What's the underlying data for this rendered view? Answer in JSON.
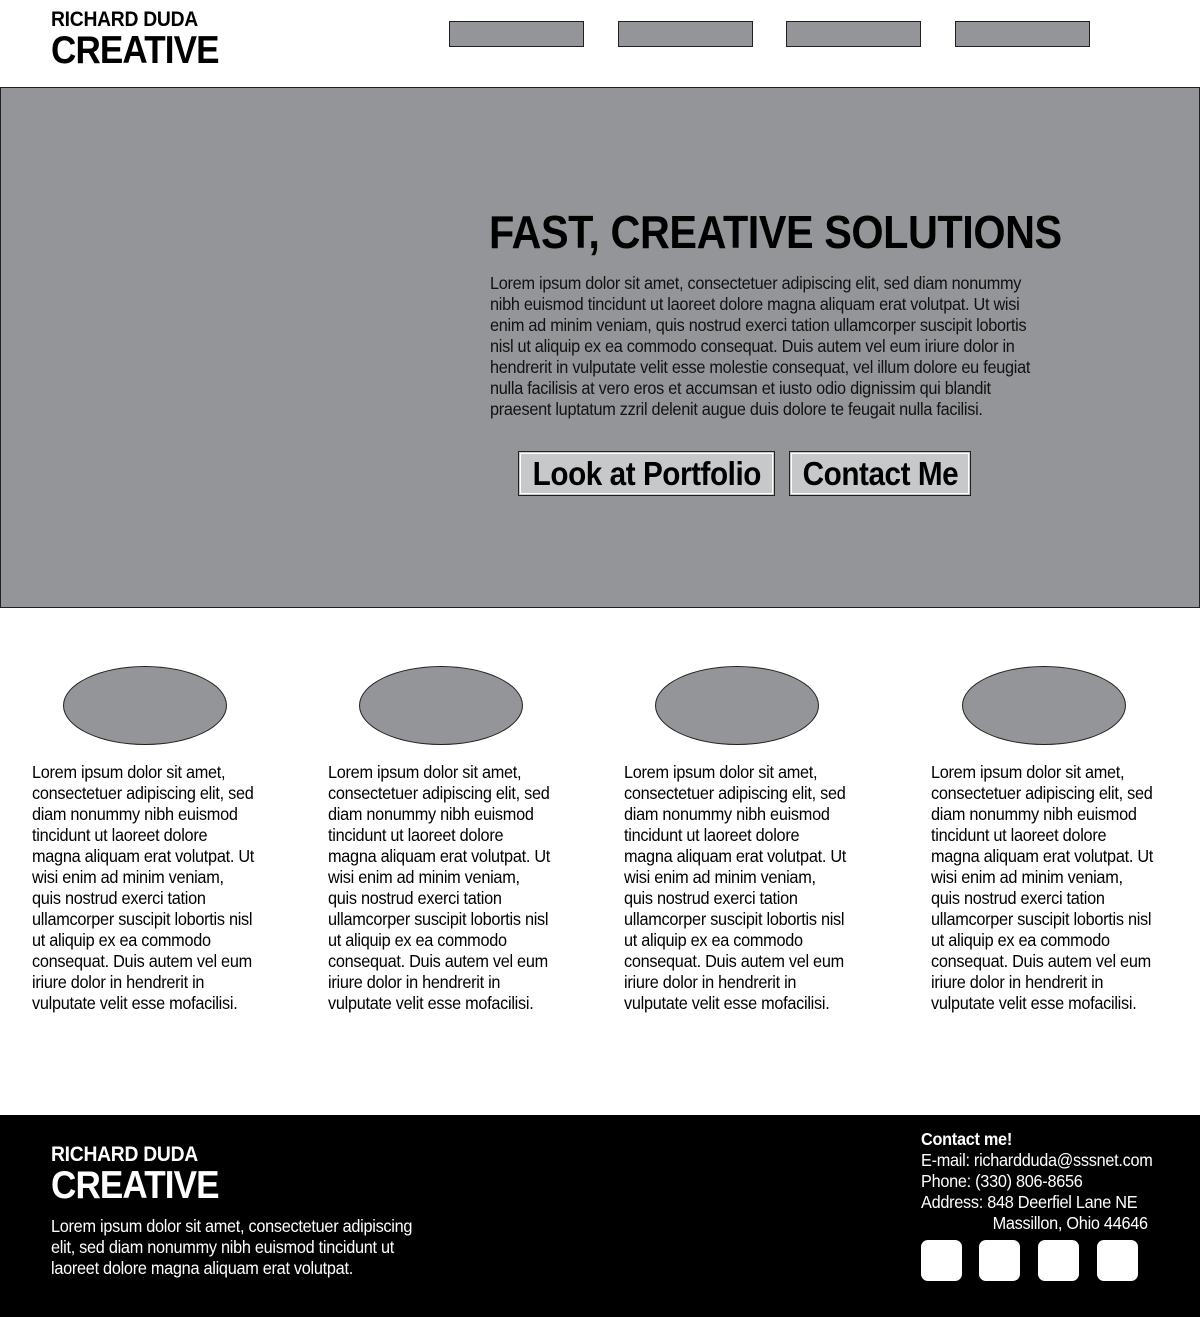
{
  "header": {
    "logo_line1": "RICHARD DUDA",
    "logo_line2": "CREATIVE",
    "nav_items": [
      "",
      "",
      "",
      ""
    ]
  },
  "hero": {
    "title": "FAST, CREATIVE SOLUTIONS",
    "text": "Lorem ipsum dolor sit amet, consectetuer adipiscing elit, sed diam nonummy nibh euismod tincidunt ut laoreet dolore magna aliquam erat volutpat. Ut wisi enim ad minim veniam, quis nostrud exerci tation ullamcorper suscipit lobortis nisl ut aliquip ex ea commodo consequat. Duis autem vel eum iriure dolor in hendrerit in vulputate velit esse molestie consequat, vel illum dolore eu feugiat nulla facilisis at vero eros et accumsan et iusto odio dignissim qui blandit praesent luptatum zzril delenit augue duis dolore te feugait nulla facilisi.",
    "portfolio_button": "Look at Portfolio",
    "contact_button": "Contact Me"
  },
  "features": [
    {
      "text": "Lorem ipsum dolor sit amet, consectetuer adipiscing elit, sed diam nonummy nibh euismod tincidunt ut laoreet dolore magna aliquam erat volutpat. Ut wisi enim ad minim veniam, quis nostrud exerci tation ullamcorper suscipit lobortis nisl ut aliquip ex ea commodo consequat. Duis autem vel eum iriure dolor in hendrerit in vulputate velit esse mofacilisi."
    },
    {
      "text": "Lorem ipsum dolor sit amet, consectetuer adipiscing elit, sed diam nonummy nibh euismod tincidunt ut laoreet dolore magna aliquam erat volutpat. Ut wisi enim ad minim veniam, quis nostrud exerci tation ullamcorper suscipit lobortis nisl ut aliquip ex ea commodo consequat. Duis autem vel eum iriure dolor in hendrerit in vulputate velit esse mofacilisi."
    },
    {
      "text": "Lorem ipsum dolor sit amet, consectetuer adipiscing elit, sed diam nonummy nibh euismod tincidunt ut laoreet dolore magna aliquam erat volutpat. Ut wisi enim ad minim veniam, quis nostrud exerci tation ullamcorper suscipit lobortis nisl ut aliquip ex ea commodo consequat. Duis autem vel eum iriure dolor in hendrerit in vulputate velit esse mofacilisi."
    },
    {
      "text": "Lorem ipsum dolor sit amet, consectetuer adipiscing elit, sed diam nonummy nibh euismod tincidunt ut laoreet dolore magna aliquam erat volutpat. Ut wisi enim ad minim veniam, quis nostrud exerci tation ullamcorper suscipit lobortis nisl ut aliquip ex ea commodo consequat. Duis autem vel eum iriure dolor in hendrerit in vulputate velit esse mofacilisi."
    }
  ],
  "footer": {
    "logo_line1": "RICHARD DUDA",
    "logo_line2": "CREATIVE",
    "text": "Lorem ipsum dolor sit amet, consectetuer adipiscing elit, sed diam nonummy nibh euismod tincidunt ut laoreet dolore magna aliquam erat volutpat.",
    "contact": {
      "heading": "Contact me!",
      "email": "E-mail: richardduda@sssnet.com",
      "phone": "Phone:  (330) 806-8656",
      "address_line1": "Address:  848 Deerfiel Lane NE",
      "address_line2": "Massillon, Ohio 44646"
    },
    "social_icons": [
      "social-icon-1",
      "social-icon-2",
      "social-icon-3",
      "social-icon-4"
    ]
  },
  "colors": {
    "placeholder_gray": "#939598",
    "button_gray": "#c7c8ca",
    "footer_bg": "#000000",
    "border": "#231f20"
  }
}
